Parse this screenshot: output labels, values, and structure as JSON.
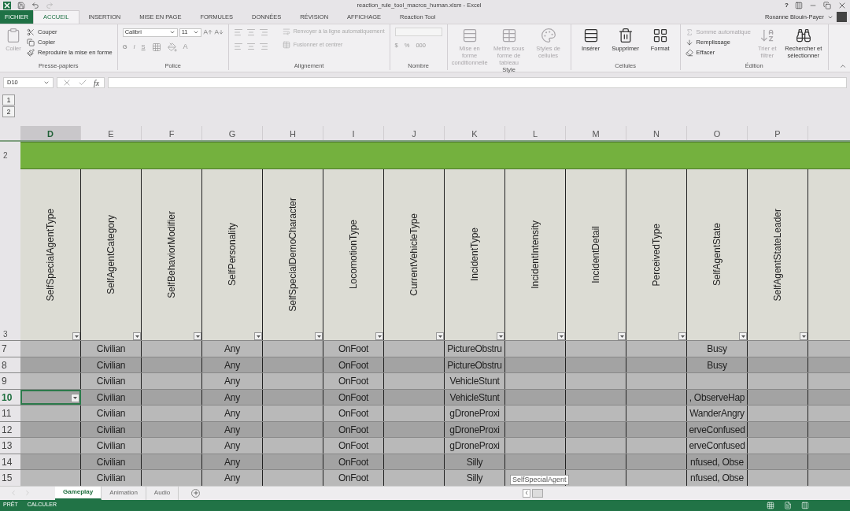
{
  "window": {
    "title": "reaction_rule_tool_macros_human.xlsm - Excel",
    "help": "?"
  },
  "ribbon_tabs": [
    {
      "label": "FICHIER",
      "kind": "file",
      "selected": false
    },
    {
      "label": "ACCUEIL",
      "kind": "tab",
      "selected": true
    },
    {
      "label": "INSERTION",
      "kind": "tab",
      "selected": false
    },
    {
      "label": "MISE EN PAGE",
      "kind": "tab",
      "selected": false
    },
    {
      "label": "FORMULES",
      "kind": "tab",
      "selected": false
    },
    {
      "label": "DONNÉES",
      "kind": "tab",
      "selected": false
    },
    {
      "label": "RÉVISION",
      "kind": "tab",
      "selected": false
    },
    {
      "label": "AFFICHAGE",
      "kind": "tab",
      "selected": false
    },
    {
      "label": "Reaction Tool",
      "kind": "tab",
      "selected": false
    }
  ],
  "user": {
    "name": "Roxanne Blouin-Payer"
  },
  "ribbon": {
    "clipboard": {
      "label": "Presse-papiers",
      "paste": {
        "label": "Coller",
        "disabled": true
      },
      "items": [
        {
          "label": "Couper",
          "disabled": false
        },
        {
          "label": "Copier",
          "disabled": false
        },
        {
          "label": "Reproduire la mise en forme",
          "disabled": false
        }
      ]
    },
    "font": {
      "label": "Police",
      "family": "Calibri",
      "size": "11",
      "bold": "G",
      "italic": "I",
      "underline": "S",
      "font_color_label": "A"
    },
    "alignment": {
      "label": "Alignement",
      "wrap": "Renvoyer à la ligne automatiquement",
      "merge": "Fusionner et centrer"
    },
    "number": {
      "label": "Nombre",
      "currency": "$",
      "percent": "%",
      "thousands": "000"
    },
    "style": {
      "label": "Style",
      "items": [
        {
          "label": "Mise en forme conditionnelle",
          "disabled": true
        },
        {
          "label": "Mettre sous forme de tableau",
          "disabled": true
        },
        {
          "label": "Styles de cellules",
          "disabled": true
        }
      ]
    },
    "cells": {
      "label": "Cellules",
      "items": [
        {
          "label": "Insérer",
          "disabled": false
        },
        {
          "label": "Supprimer",
          "disabled": false
        },
        {
          "label": "Format",
          "disabled": false
        }
      ]
    },
    "editing": {
      "label": "Édition",
      "small": [
        {
          "label": "Somme automatique",
          "disabled": true
        },
        {
          "label": "Remplissage",
          "disabled": false
        },
        {
          "label": "Effacer",
          "disabled": false
        }
      ],
      "large": [
        {
          "label": "Trier et filtrer",
          "disabled": true
        },
        {
          "label": "Rechercher et sélectionner",
          "disabled": false
        }
      ]
    }
  },
  "formula_bar": {
    "name_box": "D10",
    "function_label": "fx"
  },
  "outline_levels": [
    "1",
    "2"
  ],
  "sheet": {
    "columns": [
      {
        "letter": "D",
        "selected": true
      },
      {
        "letter": "E",
        "selected": false
      },
      {
        "letter": "F",
        "selected": false
      },
      {
        "letter": "G",
        "selected": false
      },
      {
        "letter": "H",
        "selected": false
      },
      {
        "letter": "I",
        "selected": false
      },
      {
        "letter": "J",
        "selected": false
      },
      {
        "letter": "K",
        "selected": false
      },
      {
        "letter": "L",
        "selected": false
      },
      {
        "letter": "M",
        "selected": false
      },
      {
        "letter": "N",
        "selected": false
      },
      {
        "letter": "O",
        "selected": false
      },
      {
        "letter": "P",
        "selected": false
      }
    ],
    "band_row": "2",
    "header_row": "3",
    "headers": [
      "SelfSpecialAgentType",
      "SelfAgentCategory",
      "SelfBehaviorModifier",
      "SelfPersonality",
      "SelfSpecialDemoCharacter",
      "LocomotionType",
      "CurrentVehicleType",
      "IncidentType",
      "IncidentIntensity",
      "IncidentDetail",
      "PerceivedType",
      "SelfAgentState",
      "SelfAgentStateLeader"
    ],
    "rows": [
      {
        "number": "7",
        "selected": false,
        "cells": [
          "",
          "Civilian",
          "",
          "Any",
          "",
          "OnFoot",
          "",
          "PictureObstru",
          "",
          "",
          "",
          "Busy",
          ""
        ]
      },
      {
        "number": "8",
        "selected": false,
        "cells": [
          "",
          "Civilian",
          "",
          "Any",
          "",
          "OnFoot",
          "",
          "PictureObstru",
          "",
          "",
          "",
          "Busy",
          ""
        ]
      },
      {
        "number": "9",
        "selected": false,
        "cells": [
          "",
          "Civilian",
          "",
          "Any",
          "",
          "OnFoot",
          "",
          "VehicleStunt",
          "",
          "",
          "",
          "",
          ""
        ]
      },
      {
        "number": "10",
        "selected": true,
        "cells": [
          "",
          "Civilian",
          "",
          "Any",
          "",
          "OnFoot",
          "",
          "VehicleStunt",
          "",
          "",
          "",
          ", ObserveHap",
          ""
        ]
      },
      {
        "number": "11",
        "selected": false,
        "cells": [
          "",
          "Civilian",
          "",
          "Any",
          "",
          "OnFoot",
          "",
          "gDroneProxi",
          "",
          "",
          "",
          "WanderAngry",
          ""
        ]
      },
      {
        "number": "12",
        "selected": false,
        "cells": [
          "",
          "Civilian",
          "",
          "Any",
          "",
          "OnFoot",
          "",
          "gDroneProxi",
          "",
          "",
          "",
          "erveConfused",
          ""
        ]
      },
      {
        "number": "13",
        "selected": false,
        "cells": [
          "",
          "Civilian",
          "",
          "Any",
          "",
          "OnFoot",
          "",
          "gDroneProxi",
          "",
          "",
          "",
          "erveConfused",
          ""
        ]
      },
      {
        "number": "14",
        "selected": false,
        "cells": [
          "",
          "Civilian",
          "",
          "Any",
          "",
          "OnFoot",
          "",
          "Silly",
          "",
          "",
          "",
          "nfused, Obse",
          ""
        ]
      },
      {
        "number": "15",
        "selected": false,
        "cells": [
          "",
          "Civilian",
          "",
          "Any",
          "",
          "OnFoot",
          "",
          "Silly",
          "",
          "",
          "",
          "nfused, Obse",
          ""
        ]
      }
    ],
    "tooltip": "SelfSpecialAgent"
  },
  "sheet_tabs": [
    {
      "label": "Gameplay",
      "selected": true
    },
    {
      "label": "Animation",
      "selected": false
    },
    {
      "label": "Audio",
      "selected": false
    }
  ],
  "status_bar": {
    "ready": "PRÊT",
    "calculate": "CALCULER"
  }
}
